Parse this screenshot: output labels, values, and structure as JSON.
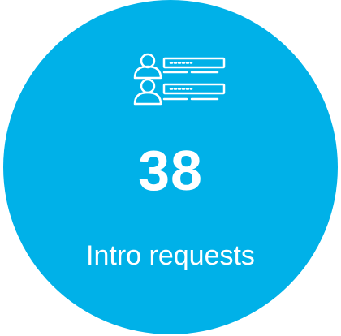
{
  "stat": {
    "icon": "users-list-icon",
    "value": "38",
    "label": "Intro requests",
    "circle_color": "#00b1e8",
    "text_color": "#ffffff"
  }
}
